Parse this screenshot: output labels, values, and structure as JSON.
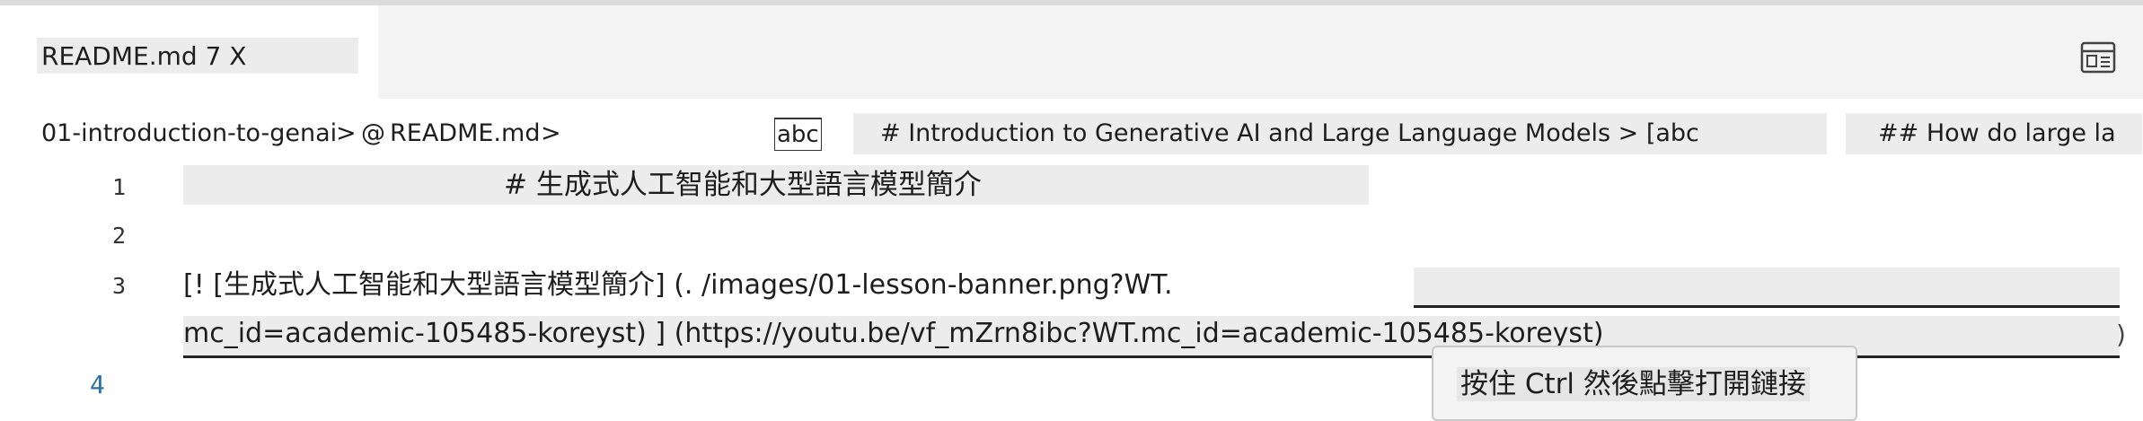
{
  "tab": {
    "label": "README.md 7 X"
  },
  "breadcrumb": {
    "folder": "01-introduction-to-genai",
    "separator1": ">",
    "at": "@",
    "file": "README.md",
    "separator2": ">",
    "abc_badge": "abc",
    "heading1": "# Introduction to Generative AI and Large Language Models > [abc",
    "heading2": "## How do large la"
  },
  "editor": {
    "line_numbers": [
      "1",
      "2",
      "3",
      "4"
    ],
    "line1": "# 生成式人工智能和大型語言模型簡介",
    "line3_part1": "[! [生成式人工智能和大型語言模型簡介] (. /images/01-lesson-banner.png?WT.",
    "line3_part2": "mc_id=academic-105485-koreyst) ] (https://youtu.be/vf_mZrn8ibc?WT.mc_id=academic-105485-koreyst)"
  },
  "tooltip": {
    "text": "按住 Ctrl 然後點擊打開鏈接"
  },
  "icons": {
    "layout": "layout-toggle-icon"
  },
  "colors": {
    "tabbar": "#f3f3f3",
    "highlight": "#ececec",
    "line_number_active": "#2a6fa8"
  }
}
